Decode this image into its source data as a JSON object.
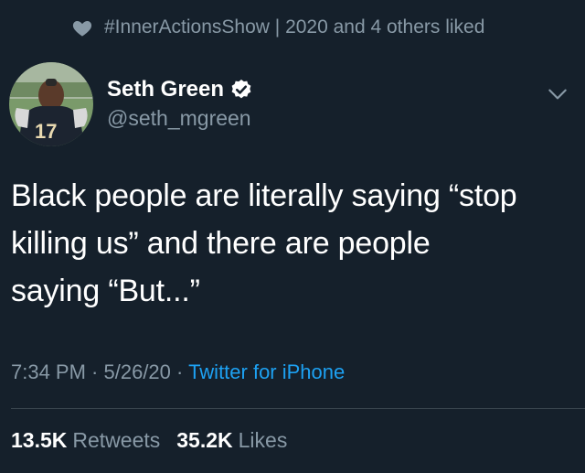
{
  "social_context": {
    "text": "#InnerActionsShow | 2020 and 4 others liked",
    "icon": "heart-icon"
  },
  "author": {
    "name": "Seth Green",
    "handle": "@seth_mgreen",
    "verified": true,
    "jersey_number": "17"
  },
  "tweet": {
    "lines": [
      "Black people are literally saying “stop",
      "killing us” and there are people",
      "saying “But...”"
    ]
  },
  "meta": {
    "time": "7:34 PM",
    "sep1": " · ",
    "date": "5/26/20",
    "sep2": " · ",
    "source": "Twitter for iPhone"
  },
  "stats": {
    "retweets_count": "13.5K",
    "retweets_label": "Retweets",
    "likes_count": "35.2K",
    "likes_label": "Likes"
  },
  "colors": {
    "background": "#15202b",
    "secondary_text": "#8899a6",
    "accent": "#1da1f2"
  }
}
